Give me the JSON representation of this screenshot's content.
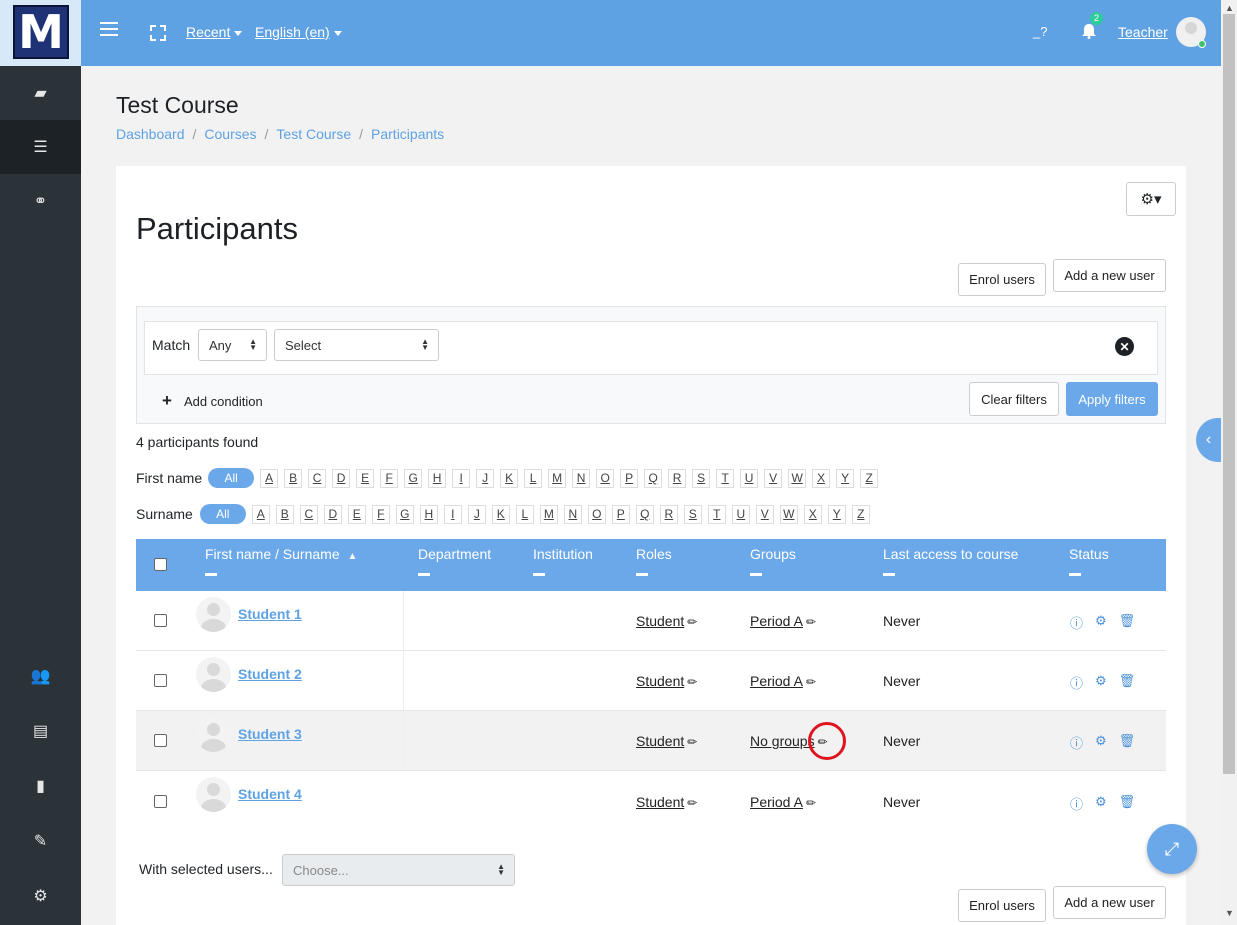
{
  "topbar": {
    "logo_letter": "M",
    "recent": "Recent",
    "language": "English (en)",
    "help": "_?",
    "notifications_count": "2",
    "user": "Teacher"
  },
  "course": {
    "title": "Test Course",
    "breadcrumb": [
      "Dashboard",
      "Courses",
      "Test Course",
      "Participants"
    ]
  },
  "participants": {
    "heading": "Participants",
    "enrol_users": "Enrol users",
    "add_new_user": "Add a new user",
    "filter": {
      "match_label": "Match",
      "match_value": "Any",
      "select_value": "Select",
      "add_condition": "Add condition",
      "clear_filters": "Clear filters",
      "apply_filters": "Apply filters"
    },
    "found": "4 participants found",
    "first_name_label": "First name",
    "surname_label": "Surname",
    "all_label": "All",
    "letters": [
      "A",
      "B",
      "C",
      "D",
      "E",
      "F",
      "G",
      "H",
      "I",
      "J",
      "K",
      "L",
      "M",
      "N",
      "O",
      "P",
      "Q",
      "R",
      "S",
      "T",
      "U",
      "V",
      "W",
      "X",
      "Y",
      "Z"
    ],
    "columns": {
      "first_name": "First name",
      "slash": " / ",
      "surname": "Surname",
      "department": "Department",
      "institution": "Institution",
      "roles": "Roles",
      "groups": "Groups",
      "last_access": "Last access to course",
      "status": "Status"
    },
    "rows": [
      {
        "name": "Student 1",
        "role": "Student",
        "group": "Period A",
        "last_access": "Never"
      },
      {
        "name": "Student 2",
        "role": "Student",
        "group": "Period A",
        "last_access": "Never"
      },
      {
        "name": "Student 3",
        "role": "Student",
        "group": "No groups",
        "last_access": "Never"
      },
      {
        "name": "Student 4",
        "role": "Student",
        "group": "Period A",
        "last_access": "Never"
      }
    ],
    "with_selected": "With selected users...",
    "choose": "Choose..."
  },
  "colors": {
    "navbar": "#5fa2e3",
    "accent": "#6ba8ea",
    "sidebar": "#2b3238",
    "highlight": "#e0141e"
  }
}
